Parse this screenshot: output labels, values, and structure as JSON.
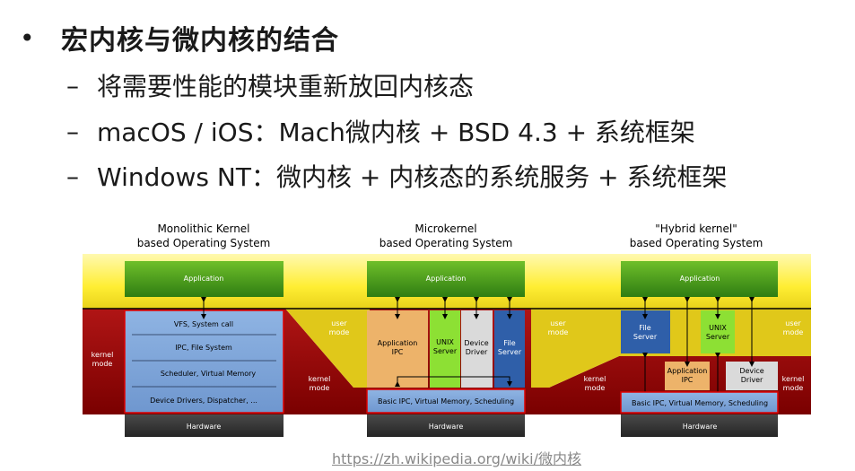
{
  "slide": {
    "bullet_symbol": "•",
    "title": "宏内核与微内核的结合",
    "dash": "–",
    "points": [
      "将需要性能的模块重新放回内核态",
      "macOS / iOS：Mach微内核 + BSD 4.3 + 系统框架",
      "Windows NT：微内核 + 内核态的系统服务 + 系统框架"
    ],
    "source": "https://zh.wikipedia.org/wiki/微内核"
  },
  "diagram": {
    "mono": {
      "title1": "Monolithic Kernel",
      "title2": "based Operating System",
      "application": "Application",
      "layers": [
        "VFS, System call",
        "IPC, File System",
        "Scheduler, Virtual Memory",
        "Device Drivers, Dispatcher, ..."
      ],
      "hardware": "Hardware",
      "kernel_mode": [
        "kernel",
        "mode"
      ]
    },
    "micro": {
      "title1": "Microkernel",
      "title2": "based Operating System",
      "application": "Application",
      "app_ipc": [
        "Application",
        "IPC"
      ],
      "unix_server": [
        "UNIX",
        "Server"
      ],
      "device_driver": [
        "Device",
        "Driver"
      ],
      "file_server": [
        "File",
        "Server"
      ],
      "basic": "Basic IPC, Virtual Memory, Scheduling",
      "hardware": "Hardware",
      "user_mode": [
        "user",
        "mode"
      ],
      "kernel_mode": [
        "kernel",
        "mode"
      ]
    },
    "hybrid": {
      "title1": "\"Hybrid kernel\"",
      "title2": "based Operating System",
      "application": "Application",
      "file_server": [
        "File",
        "Server"
      ],
      "unix_server": [
        "UNIX",
        "Server"
      ],
      "app_ipc": [
        "Application",
        "IPC"
      ],
      "device_driver": [
        "Device",
        "Driver"
      ],
      "basic": "Basic IPC, Virtual Memory, Scheduling",
      "hardware": "Hardware",
      "user_mode_mid": [
        "user",
        "mode"
      ],
      "kernel_mode_mid": [
        "kernel",
        "mode"
      ],
      "user_mode_right": [
        "user",
        "mode"
      ],
      "kernel_mode_right": [
        "kernel",
        "mode"
      ]
    }
  }
}
